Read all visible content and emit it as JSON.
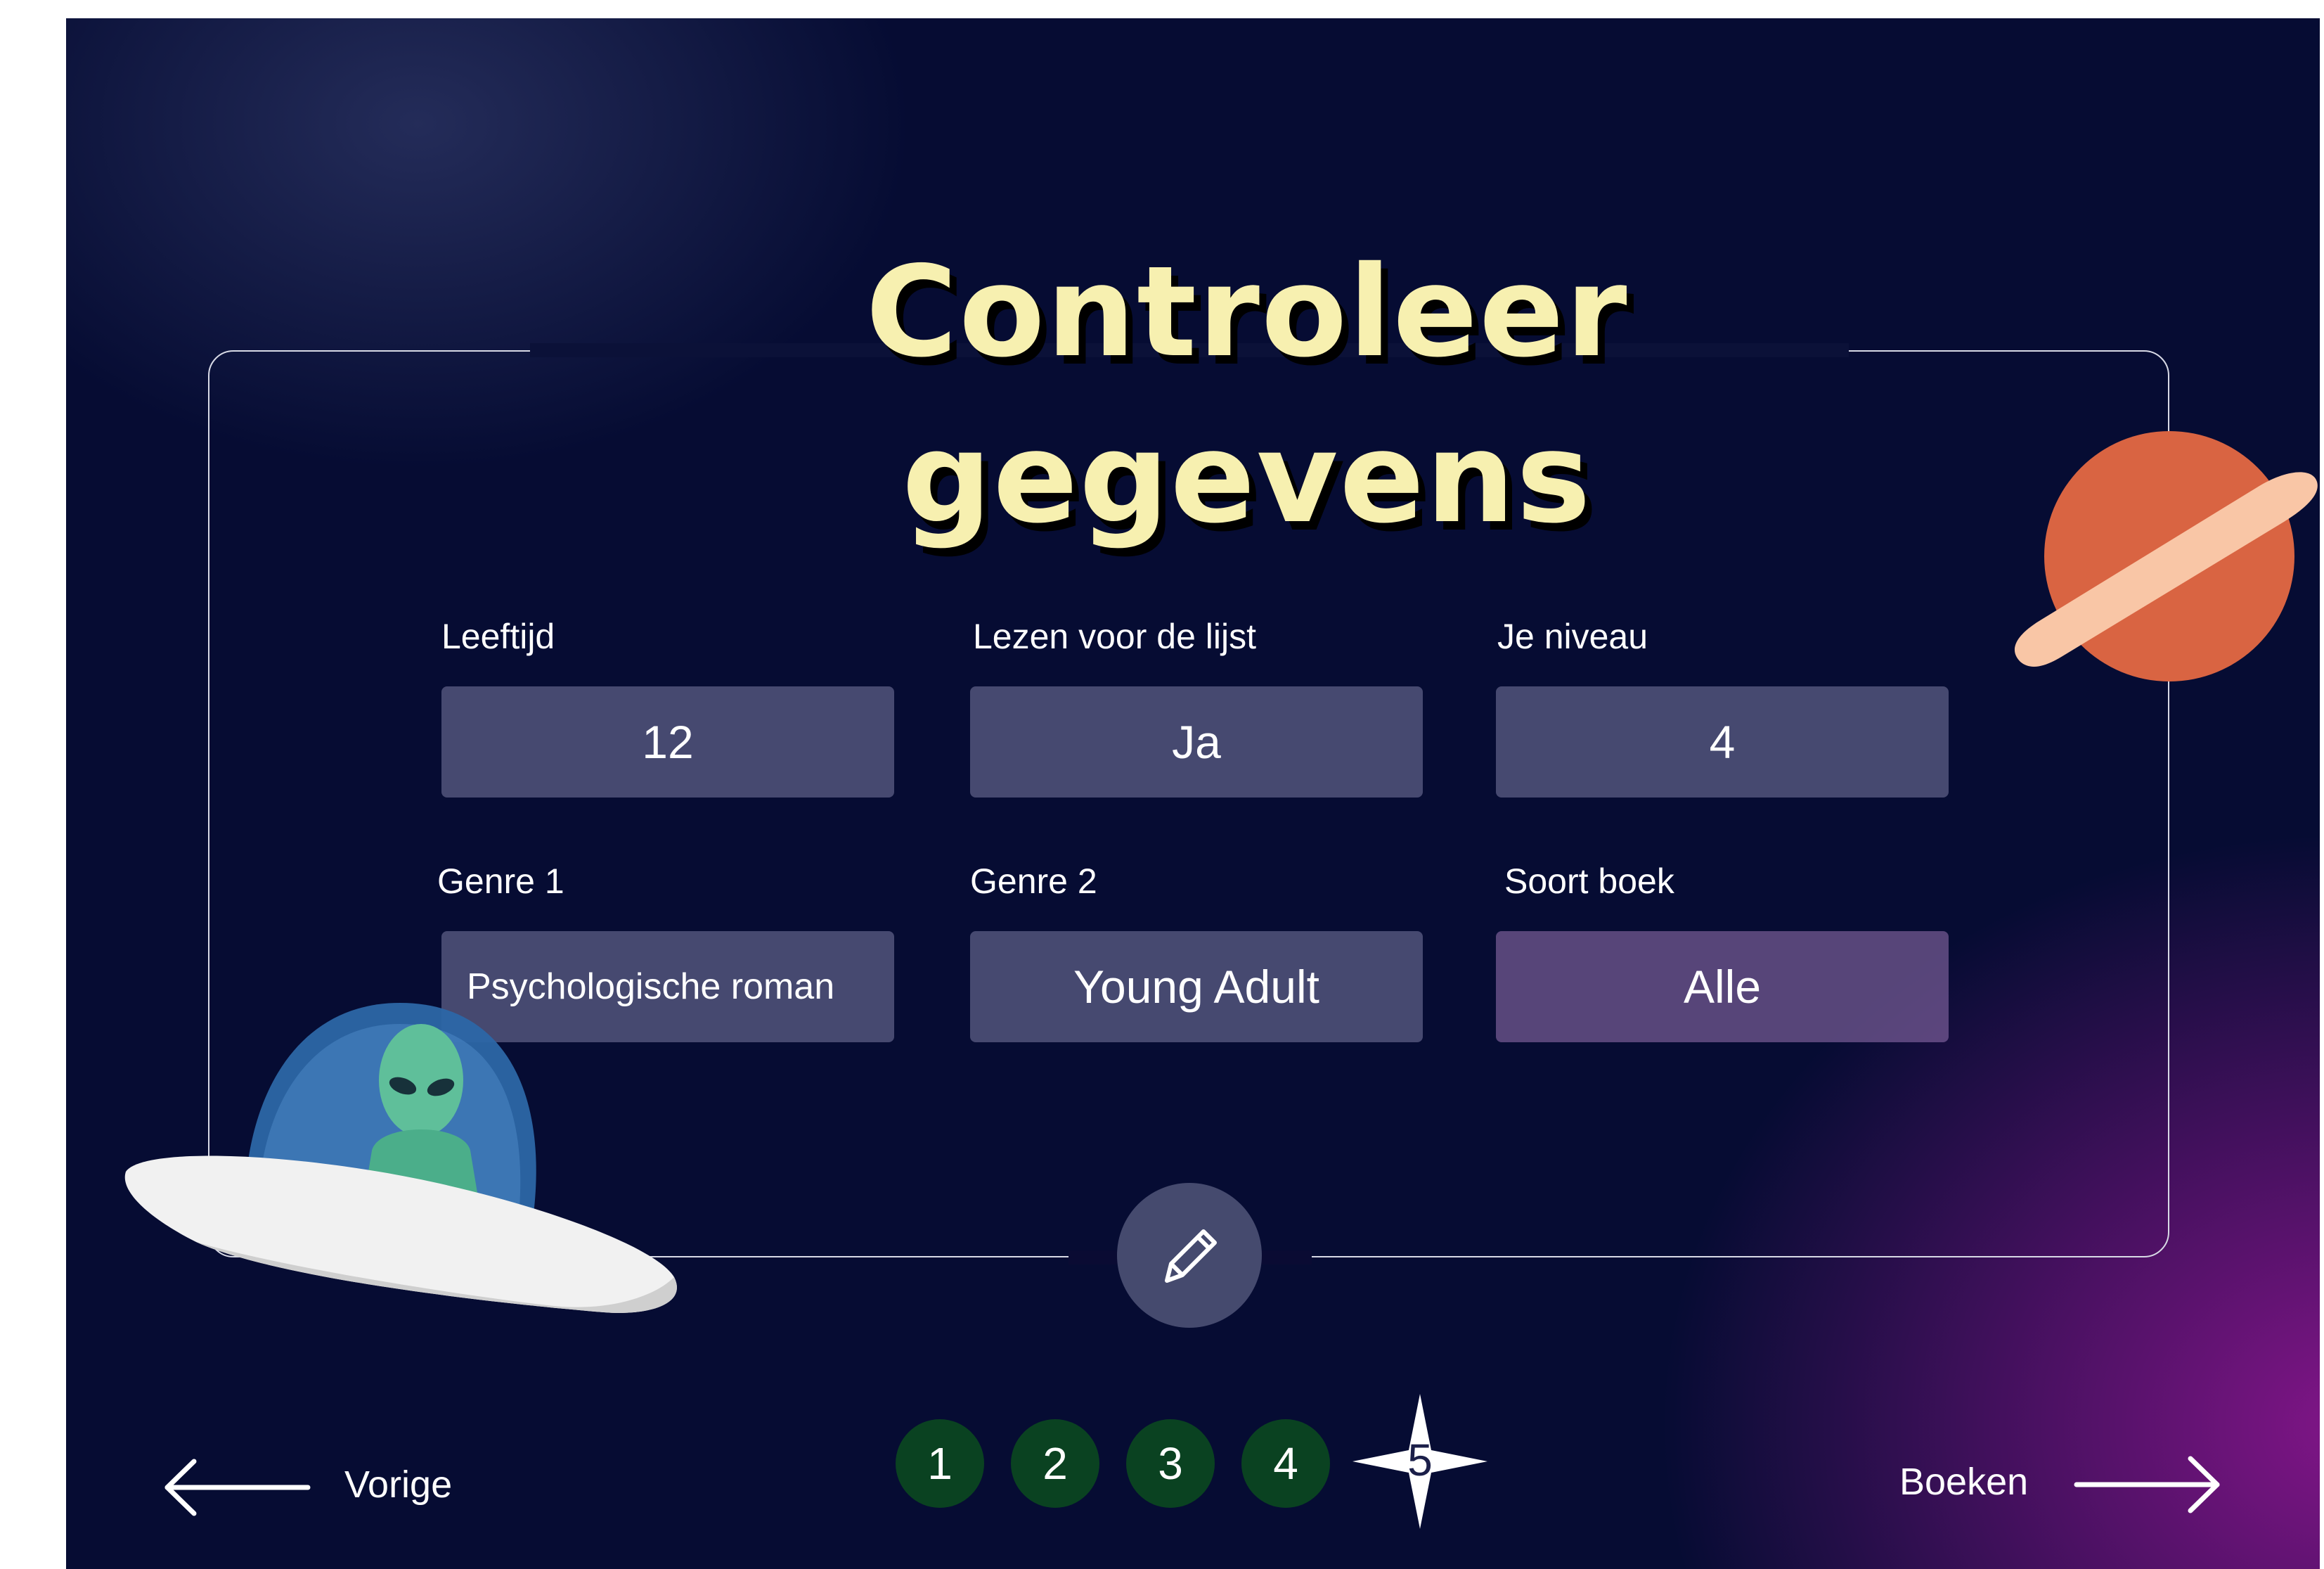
{
  "page": {
    "title_line1": "Controleer",
    "title_line2": "gegevens"
  },
  "fields": [
    {
      "label": "Leeftijd",
      "value": "12"
    },
    {
      "label": "Lezen voor de lijst",
      "value": "Ja"
    },
    {
      "label": "Je niveau",
      "value": "4"
    },
    {
      "label": "Genre 1",
      "value": "Psychologische roman"
    },
    {
      "label": "Genre 2",
      "value": "Young Adult"
    },
    {
      "label": "Soort boek",
      "value": "Alle"
    }
  ],
  "edit": {
    "icon": "pencil-icon"
  },
  "steps": {
    "items": [
      "1",
      "2",
      "3",
      "4",
      "5"
    ],
    "current": "5"
  },
  "nav": {
    "prev_label": "Vorige",
    "next_label": "Boeken"
  },
  "colors": {
    "title": "#f7f0b0",
    "step_bg": "#0a4221",
    "planet": "#d96442",
    "ring": "#f9c6a6"
  }
}
